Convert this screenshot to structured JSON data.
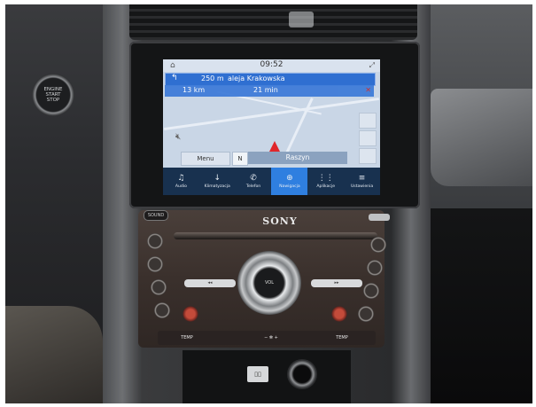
{
  "screen": {
    "clock": "09:52",
    "nav": {
      "distance": "250 m",
      "street": "aleja Krakowska",
      "remaining_km": "13 km",
      "remaining_time": "21 min"
    },
    "menu_label": "Menu",
    "direction": "N",
    "location": "Raszyn",
    "dock": [
      {
        "label": "Audio",
        "icon": "music-note-icon",
        "glyph": "♫"
      },
      {
        "label": "Klimatyzacja",
        "icon": "climate-icon",
        "glyph": "↓"
      },
      {
        "label": "Telefon",
        "icon": "phone-icon",
        "glyph": "✆"
      },
      {
        "label": "Nawigacja",
        "icon": "navigation-icon",
        "glyph": "⊕"
      },
      {
        "label": "Aplikacje",
        "icon": "apps-icon",
        "glyph": "⋮⋮"
      },
      {
        "label": "Ustawienia",
        "icon": "settings-icon",
        "glyph": "≡"
      }
    ]
  },
  "console": {
    "brand": "SONY",
    "sound_label": "SOUND",
    "start_label_1": "ENGINE",
    "start_label_2": "START",
    "start_label_3": "STOP",
    "vol_label": "VOL",
    "temp_left": "TEMP",
    "temp_right": "TEMP"
  },
  "colors": {
    "nav_blue": "#2f6fd1",
    "dock_active": "#2f7fe0",
    "position_marker": "#e0262b"
  }
}
